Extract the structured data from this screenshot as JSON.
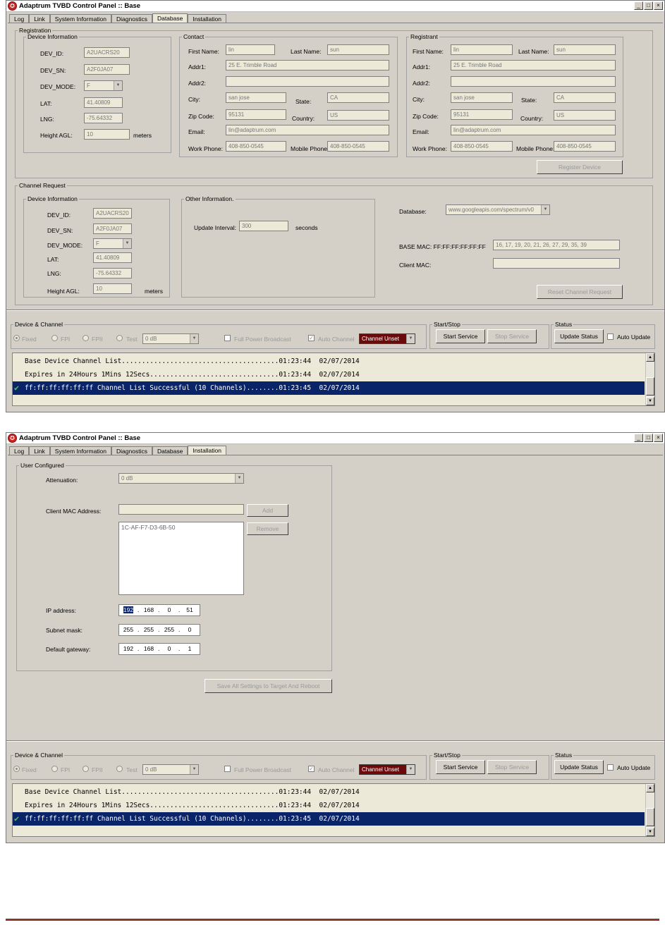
{
  "window_title": "Adaptrum TVBD Control Panel :: Base",
  "tabs": [
    "Log",
    "Link",
    "System Information",
    "Diagnostics",
    "Database",
    "Installation"
  ],
  "winbtns": [
    "_",
    "□",
    "×"
  ],
  "database": {
    "registration_legend": "Registration",
    "devinfo": {
      "legend": "Device Information",
      "dev_id_label": "DEV_ID:",
      "dev_id": "A2UACRS20",
      "dev_sn_label": "DEV_SN:",
      "dev_sn": "A2F0JA07",
      "dev_mode_label": "DEV_MODE:",
      "dev_mode": "F",
      "lat_label": "LAT:",
      "lat": "41.40809",
      "lng_label": "LNG:",
      "lng": "-75.64332",
      "height_label": "Height AGL:",
      "height": "10",
      "height_unit": "meters"
    },
    "contact": {
      "legend": "Contact",
      "first_name_label": "First Name:",
      "first_name": "lin",
      "last_name_label": "Last Name:",
      "last_name": "sun",
      "addr1_label": "Addr1:",
      "addr1": "25 E. Trimble Road",
      "addr2_label": "Addr2:",
      "addr2": "",
      "city_label": "City:",
      "city": "san jose",
      "state_label": "State:",
      "state": "CA",
      "zip_label": "Zip Code:",
      "zip": "95131",
      "country_label": "Country:",
      "country": "US",
      "email_label": "Email:",
      "email": "lin@adaptrum.com",
      "work_phone_label": "Work Phone:",
      "work_phone": "408-850-0545",
      "mobile_phone_label": "Mobile Phone:",
      "mobile_phone": "408-850-0545"
    },
    "registrant": {
      "legend": "Registrant",
      "first_name_label": "First Name:",
      "first_name": "lin",
      "last_name_label": "Last Name:",
      "last_name": "sun",
      "addr1_label": "Addr1:",
      "addr1": "25 E. Trimble Road",
      "addr2_label": "Addr2:",
      "addr2": "",
      "city_label": "City:",
      "city": "san jose",
      "state_label": "State:",
      "state": "CA",
      "zip_label": "Zip Code:",
      "zip": "95131",
      "country_label": "Country:",
      "country": "US",
      "email_label": "Email:",
      "email": "lin@adaptrum.com",
      "work_phone_label": "Work Phone:",
      "work_phone": "408-850-0545",
      "mobile_phone_label": "Mobile Phone:",
      "mobile_phone": "408-850-0545"
    },
    "register_button": "Register Device",
    "channel_request": {
      "legend": "Channel Request",
      "devinfo_legend": "Device Information",
      "dev_id_label": "DEV_ID:",
      "dev_id": "A2UACRS20",
      "dev_sn_label": "DEV_SN:",
      "dev_sn": "A2F0JA07",
      "dev_mode_label": "DEV_MODE:",
      "dev_mode": "F",
      "lat_label": "LAT:",
      "lat": "41.40809",
      "lng_label": "LNG:",
      "lng": "-75.64332",
      "height_label": "Height AGL:",
      "height": "10",
      "height_unit": "meters",
      "other_legend": "Other Information.",
      "update_interval_label": "Update Interval:",
      "update_interval": "300",
      "update_interval_unit": "seconds",
      "database_label": "Database:",
      "database_value": "www.googleapis.com/spectrum/v0",
      "base_mac_label": "BASE MAC: FF:FF:FF:FF:FF:FF",
      "base_mac_value": "16, 17, 19, 20, 21, 26, 27, 29, 35, 39",
      "client_mac_label": "Client MAC:",
      "client_mac_value": "",
      "reset_button": "Reset Channel Request"
    }
  },
  "installation": {
    "legend": "User Configured",
    "attenuation_label": "Attenuation:",
    "attenuation": "0 dB",
    "client_mac_label": "Client MAC Address:",
    "client_mac_input": "",
    "add_button": "Add",
    "remove_button": "Remove",
    "mac_list": [
      "1C-AF-F7-D3-6B-50"
    ],
    "ip_label": "IP address:",
    "ip": [
      "192",
      "168",
      "0",
      "51"
    ],
    "subnet_label": "Subnet mask:",
    "subnet": [
      "255",
      "255",
      "255",
      "0"
    ],
    "gateway_label": "Default gateway:",
    "gateway": [
      "192",
      "168",
      "0",
      "1"
    ],
    "save_button": "Save All Settings to Target And Reboot"
  },
  "bottom": {
    "device_channel_legend": "Device & Channel",
    "radio_fixed": "Fixed",
    "radio_fpi": "FPI",
    "radio_fpii": "FPII",
    "radio_test": "Test",
    "test_db": "0 dB",
    "full_power_label": "Full Power Broadcast",
    "auto_channel_label": "Auto Channel",
    "auto_channel_check": "✓",
    "channel_combo": "Channel Unset",
    "start_stop_legend": "Start/Stop",
    "start_button": "Start Service",
    "stop_button": "Stop Service",
    "status_legend": "Status",
    "update_status_button": "Update Status",
    "auto_update_label": "Auto Update"
  },
  "log": [
    "Base Device Channel List.......................................01:23:44  02/07/2014",
    "Expires in 24Hours 1Mins 12Secs................................01:23:44  02/07/2014",
    "ff:ff:ff:ff:ff:ff Channel List Successful (10 Channels)........01:23:45  02/07/2014"
  ]
}
